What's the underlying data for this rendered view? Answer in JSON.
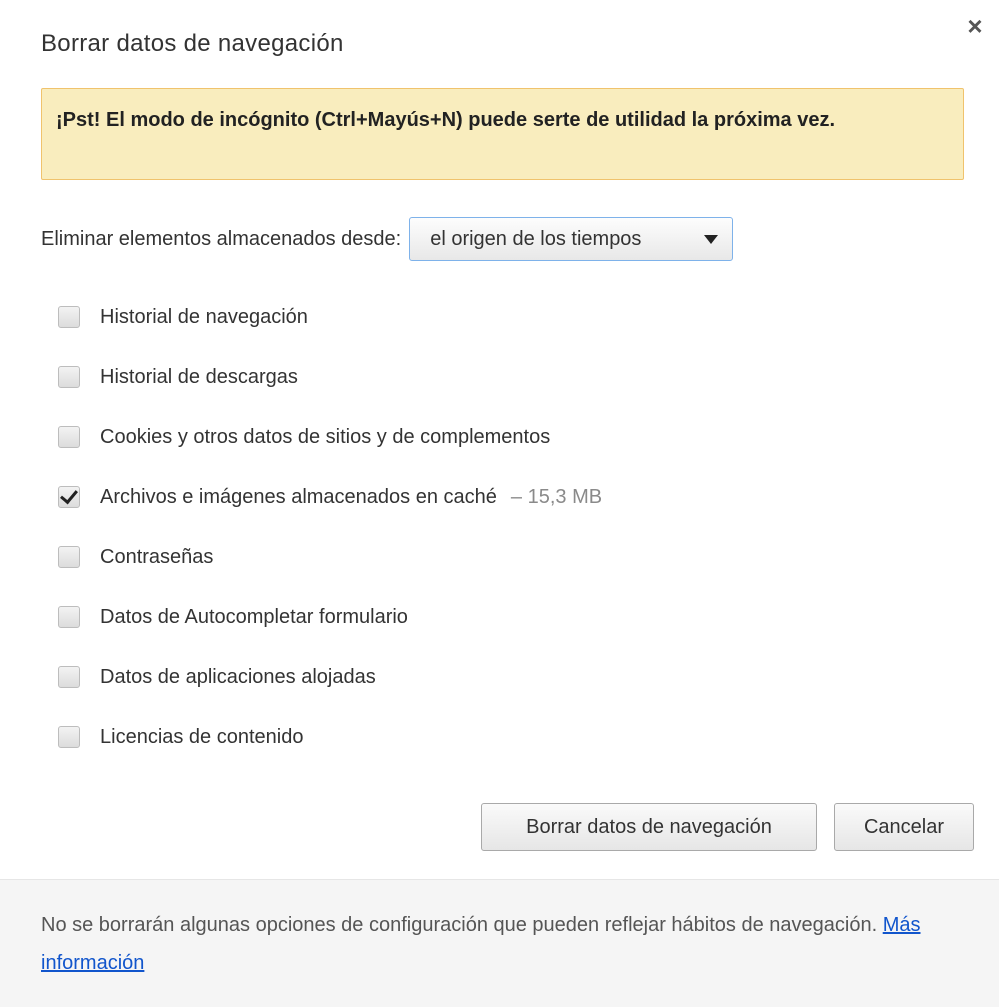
{
  "dialog": {
    "title": "Borrar datos de navegación",
    "close_icon": "close-icon"
  },
  "banner": {
    "text": "¡Pst! El modo de incógnito (Ctrl+Mayús+N) puede serte de utilidad la próxima vez."
  },
  "period": {
    "label": "Eliminar elementos almacenados desde:",
    "selected": "el origen de los tiempos"
  },
  "options": [
    {
      "label": "Historial de navegación",
      "checked": false
    },
    {
      "label": "Historial de descargas",
      "checked": false
    },
    {
      "label": "Cookies y otros datos de sitios y de complementos",
      "checked": false
    },
    {
      "label": "Archivos e imágenes almacenados en caché",
      "checked": true,
      "size": "– 15,3 MB"
    },
    {
      "label": "Contraseñas",
      "checked": false
    },
    {
      "label": "Datos de Autocompletar formulario",
      "checked": false
    },
    {
      "label": "Datos de aplicaciones alojadas",
      "checked": false
    },
    {
      "label": "Licencias de contenido",
      "checked": false
    }
  ],
  "buttons": {
    "clear_label": "Borrar datos de navegación",
    "cancel_label": "Cancelar"
  },
  "footer": {
    "text": "No se borrarán algunas opciones de configuración que pueden reflejar hábitos de navegación.",
    "link_label": "Más información"
  },
  "colors": {
    "banner_bg": "#f9edbe",
    "banner_border": "#f0c36d",
    "link": "#1155cc",
    "select_border": "#7eb2ea"
  }
}
